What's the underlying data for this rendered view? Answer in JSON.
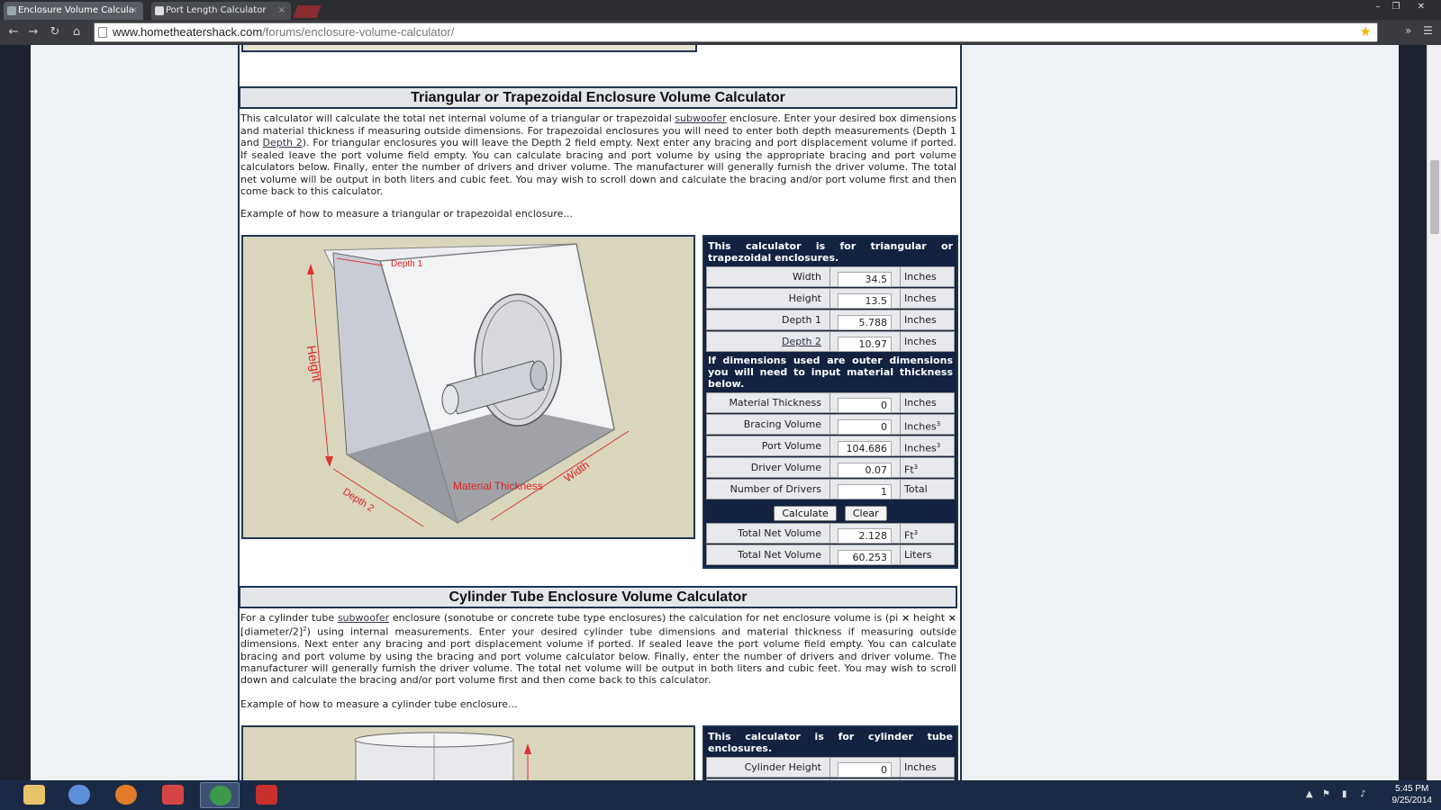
{
  "browser": {
    "tabs": [
      {
        "label": "Enclosure Volume Calcula"
      },
      {
        "label": "Port Length Calculator"
      }
    ],
    "url_host": "www.hometheatershack.com",
    "url_path": "/forums/enclosure-volume-calculator/"
  },
  "section1": {
    "title": "Triangular or Trapezoidal Enclosure Volume Calculator",
    "para_1": "This calculator will calculate the total net internal volume of a triangular or trapezoidal",
    "para_link1": "subwoofer",
    "para_2": " enclosure. Enter your desired box dimensions and material thickness if measuring outside dimensions. For trapezoidal enclosures you will need to enter both depth measurements (Depth 1 and ",
    "para_link2": "Depth 2",
    "para_3": "). For triangular enclosures you will leave the Depth 2 field empty. Next enter any bracing and port displacement volume if ported. If sealed leave the port volume field empty. You can calculate bracing and port volume by using the appropriate bracing and port volume calculators below. Finally, enter the number of drivers and driver volume. The manufacturer will generally furnish the driver volume. The total net volume will be output in both liters and cubic feet. You may wish to scroll down and calculate the bracing and/or port volume first and then come back to this calculator.",
    "example": "Example of how to measure a triangular or trapezoidal enclosure...",
    "image_labels": {
      "depth1": "Depth 1",
      "height": "Height",
      "depth2": "Depth 2",
      "material": "Material Thickness",
      "width": "Width"
    },
    "calc": {
      "header": "This calculator is for triangular or trapezoidal enclosures.",
      "width": {
        "label": "Width",
        "value": "34.5",
        "unit": "Inches"
      },
      "height": {
        "label": "Height",
        "value": "13.5",
        "unit": "Inches"
      },
      "depth1": {
        "label": "Depth 1",
        "value": "5.788",
        "unit": "Inches"
      },
      "depth2": {
        "label": "Depth 2",
        "value": "10.97",
        "unit": "Inches"
      },
      "note": "If dimensions used are outer dimensions you will need to input material thickness below.",
      "material": {
        "label": "Material Thickness",
        "value": "0",
        "unit": "Inches"
      },
      "bracing": {
        "label": "Bracing Volume",
        "value": "0",
        "unit": "Inches",
        "sup": "3"
      },
      "port": {
        "label": "Port Volume",
        "value": "104.686",
        "unit": "Inches",
        "sup": "3"
      },
      "driver": {
        "label": "Driver Volume",
        "value": "0.07",
        "unit": "Ft",
        "sup": "3"
      },
      "drivers": {
        "label": "Number of Drivers",
        "value": "1",
        "unit": "Total"
      },
      "calculate": "Calculate",
      "clear": "Clear",
      "total_ft": {
        "label": "Total Net Volume",
        "value": "2.128",
        "unit": "Ft",
        "sup": "3"
      },
      "total_l": {
        "label": "Total Net Volume",
        "value": "60.253",
        "unit": "Liters"
      }
    }
  },
  "section2": {
    "title": "Cylinder Tube Enclosure Volume Calculator",
    "para_1": "For a cylinder tube ",
    "para_link1": "subwoofer",
    "para_2": " enclosure (sonotube or concrete tube type enclosures) the calculation for net enclosure volume is (pi ",
    "times": "×",
    "para_3": " height",
    "para_4": " [diameter/2]",
    "sup": "2",
    "para_5": ") using internal measurements. Enter your desired cylinder tube dimensions and material thickness if measuring outside dimensions. Next enter any bracing and port displacement volume if ported. If sealed leave the port volume field empty. You can calculate bracing and port volume by using the bracing and port volume calculator below. Finally, enter the number of drivers and driver volume. The manufacturer will generally furnish the driver volume. The total net volume will be output in both liters and cubic feet. You may wish to scroll down and calculate the bracing and/or port volume first and then come back to this calculator.",
    "example": "Example of how to measure a cylinder tube enclosure...",
    "calc": {
      "header": "This calculator is for cylinder tube enclosures.",
      "cyl_height": {
        "label": "Cylinder Height",
        "value": "0",
        "unit": "Inches"
      }
    }
  },
  "taskbar": {
    "time": "5:45 PM",
    "date": "9/25/2014"
  }
}
